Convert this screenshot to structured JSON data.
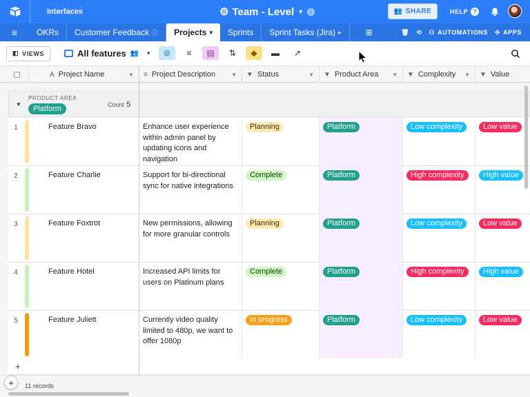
{
  "topbar": {
    "interfaces_label": "Interfaces",
    "base_name": "Team - Level",
    "share_label": "SHARE",
    "help_label": "HELP"
  },
  "tabs": [
    {
      "label": "OKRs"
    },
    {
      "label": "Customer Feedback"
    },
    {
      "label": "Projects"
    },
    {
      "label": "Sprints"
    },
    {
      "label": "Sprint Tasks (Jira)"
    }
  ],
  "tab_tools": {
    "automations_label": "AUTOMATIONS",
    "apps_label": "APPS"
  },
  "viewbar": {
    "views_label": "VIEWS",
    "view_name": "All features"
  },
  "columns": [
    {
      "label": "Project Name",
      "icon": "A"
    },
    {
      "label": "Project Description",
      "icon": "≡"
    },
    {
      "label": "Status",
      "icon": "▼"
    },
    {
      "label": "Product Area",
      "icon": "▼"
    },
    {
      "label": "Complexity",
      "icon": "▼"
    },
    {
      "label": "Value",
      "icon": "▼"
    }
  ],
  "group": {
    "field_label": "PRODUCT AREA",
    "value": "Platform",
    "count_label": "Count",
    "count": "5"
  },
  "rows": [
    {
      "num": "1",
      "name": "Feature Bravo",
      "description": "Enhance user experience within admin panel by updating icons and navigation",
      "status": "Planning",
      "product_area": "Platform",
      "complexity": "Low complexity",
      "value": "Low value"
    },
    {
      "num": "2",
      "name": "Feature Charlie",
      "description": "Support for bi-directional sync for native integrations",
      "status": "Complete",
      "product_area": "Platform",
      "complexity": "High complexity",
      "value": "High value"
    },
    {
      "num": "3",
      "name": "Feature Foxtrot",
      "description": "New permissions, allowing for more granular controls",
      "status": "Planning",
      "product_area": "Platform",
      "complexity": "Low complexity",
      "value": "Low value"
    },
    {
      "num": "4",
      "name": "Feature Hotel",
      "description": "Increased API limits for users on Platinum plans",
      "status": "Complete",
      "product_area": "Platform",
      "complexity": "High complexity",
      "value": "High value"
    },
    {
      "num": "5",
      "name": "Feature Juliett",
      "description": "Currently video quality limited to 480p, we want to offer 1080p",
      "status": "In progress",
      "product_area": "Platform",
      "complexity": "Low complexity",
      "value": "Low value"
    }
  ],
  "footer": {
    "records_label": "11 records"
  },
  "colors": {
    "brand": "#2d7ff9",
    "platform": "#20a08d",
    "planning_bg": "#ffeab6",
    "complete_bg": "#d1f7c4",
    "inprogress_bg": "#f7a11a",
    "low_complexity": "#18bfff",
    "high_complexity": "#f82b60",
    "value_red": "#f82b60",
    "value_blue": "#18bfff"
  }
}
